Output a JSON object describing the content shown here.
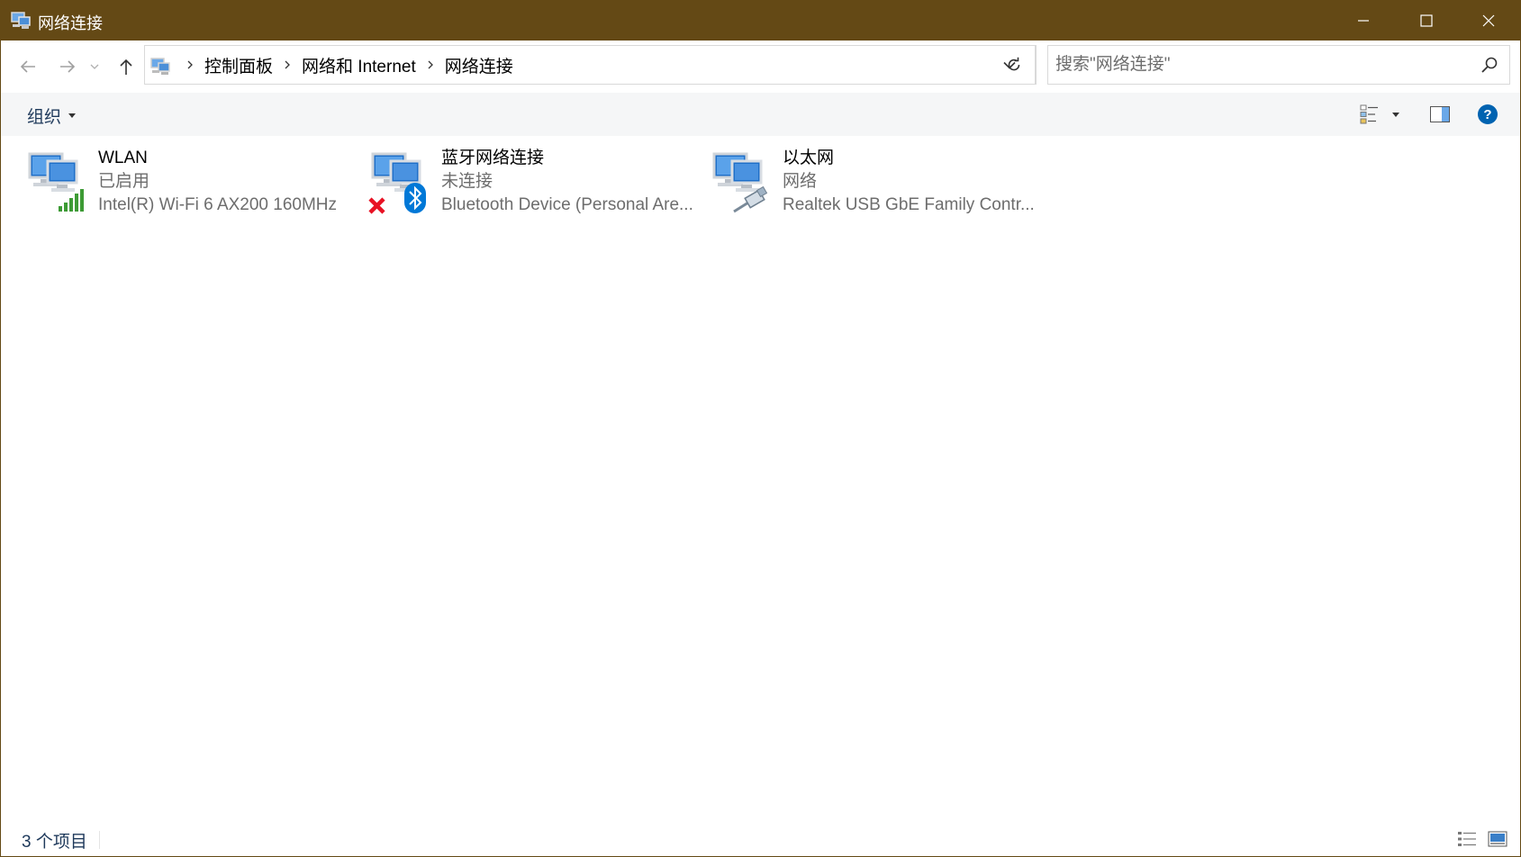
{
  "window": {
    "title": "网络连接",
    "controls": {
      "minimize": "minimize",
      "maximize": "maximize",
      "close": "close"
    }
  },
  "nav": {
    "back_icon": "arrow-left-icon",
    "forward_icon": "arrow-right-icon",
    "recent_icon": "chevron-down-icon",
    "up_icon": "arrow-up-icon"
  },
  "address": {
    "breadcrumbs": [
      "控制面板",
      "网络和 Internet",
      "网络连接"
    ]
  },
  "search": {
    "placeholder": "搜索\"网络连接\"",
    "value": ""
  },
  "toolbar": {
    "organize_label": "组织"
  },
  "items": [
    {
      "name": "WLAN",
      "status": "已启用",
      "device": "Intel(R) Wi-Fi 6 AX200 160MHz",
      "icon": "wifi-network-icon"
    },
    {
      "name": "蓝牙网络连接",
      "status": "未连接",
      "device": "Bluetooth Device (Personal Are...",
      "icon": "bluetooth-network-icon"
    },
    {
      "name": "以太网",
      "status": "网络",
      "device": "Realtek USB GbE Family Contr...",
      "icon": "ethernet-network-icon"
    }
  ],
  "statusbar": {
    "count_label": "3 个项目"
  },
  "colors": {
    "titlebar": "#644915",
    "accent_link": "#1e395b",
    "help_blue": "#0063b1",
    "signal_green": "#3d9b35",
    "disconnected_red": "#e81123",
    "bluetooth_blue": "#0078d7"
  }
}
